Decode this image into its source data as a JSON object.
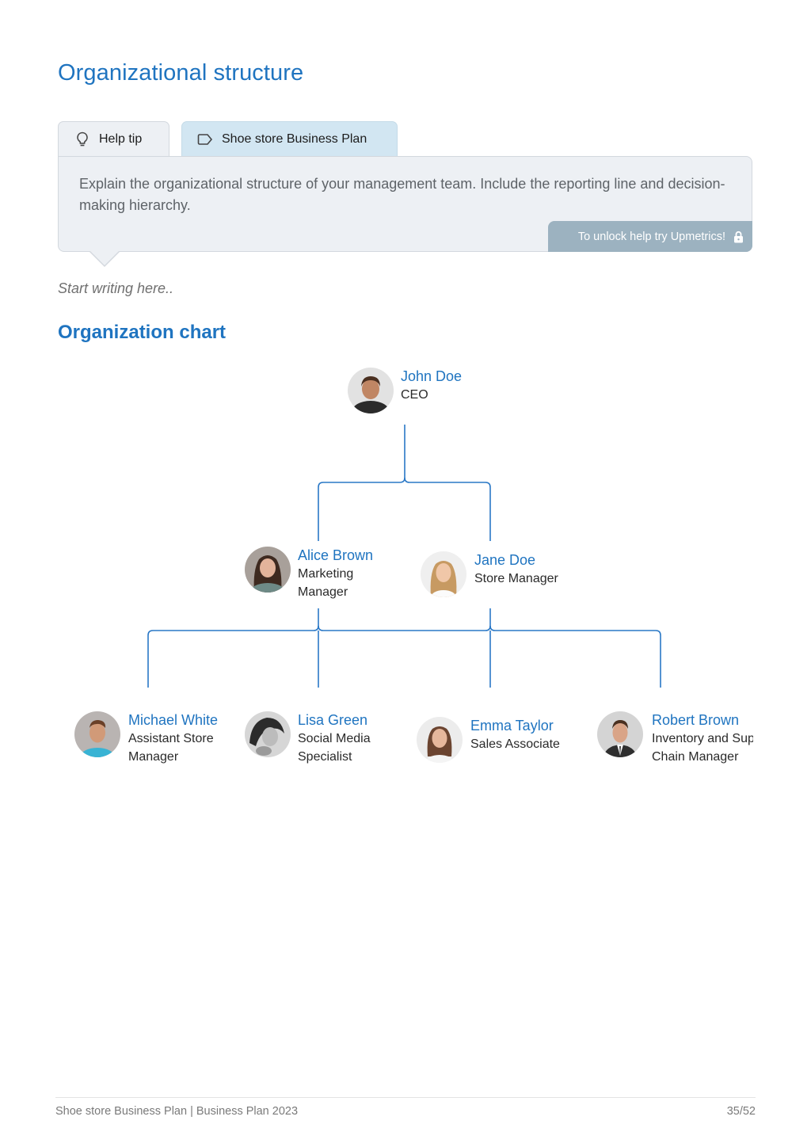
{
  "page": {
    "title": "Organizational structure"
  },
  "tabs": [
    {
      "label": "Help tip",
      "icon": "lightbulb-icon"
    },
    {
      "label": "Shoe store Business Plan",
      "icon": "tag-icon"
    }
  ],
  "help": {
    "text": "Explain the organizational structure of your management team. Include the reporting line and decision-making hierarchy.",
    "unlock_label": "To unlock help try Upmetrics!",
    "unlock_icon": "lock-icon"
  },
  "editor": {
    "placeholder": "Start writing here.."
  },
  "org_chart": {
    "title": "Organization chart",
    "line_color": "#2a78c6",
    "ceo": {
      "name": "John Doe",
      "role": "CEO",
      "avatar": "john-doe-avatar"
    },
    "managers": [
      {
        "name": "Alice Brown",
        "role": "Marketing Manager",
        "avatar": "alice-brown-avatar"
      },
      {
        "name": "Jane Doe",
        "role": "Store Manager",
        "avatar": "jane-doe-avatar"
      }
    ],
    "staff": [
      {
        "name": "Michael White",
        "role": "Assistant Store Manager",
        "avatar": "michael-white-avatar"
      },
      {
        "name": "Lisa Green",
        "role": "Social Media Specialist",
        "avatar": "lisa-green-avatar"
      },
      {
        "name": "Emma Taylor",
        "role": "Sales Associate",
        "avatar": "emma-taylor-avatar"
      },
      {
        "name": "Robert Brown",
        "role": "Inventory and Supply Chain Manager",
        "avatar": "robert-brown-avatar"
      }
    ]
  },
  "footer": {
    "left": "Shoe store Business Plan | Business Plan 2023",
    "page": "35/52"
  },
  "colors": {
    "accent": "#1f74c0",
    "help_bg": "#edf0f4",
    "plan_tab_bg": "#d2e6f2",
    "unlock_bg": "#9cb2c0"
  }
}
